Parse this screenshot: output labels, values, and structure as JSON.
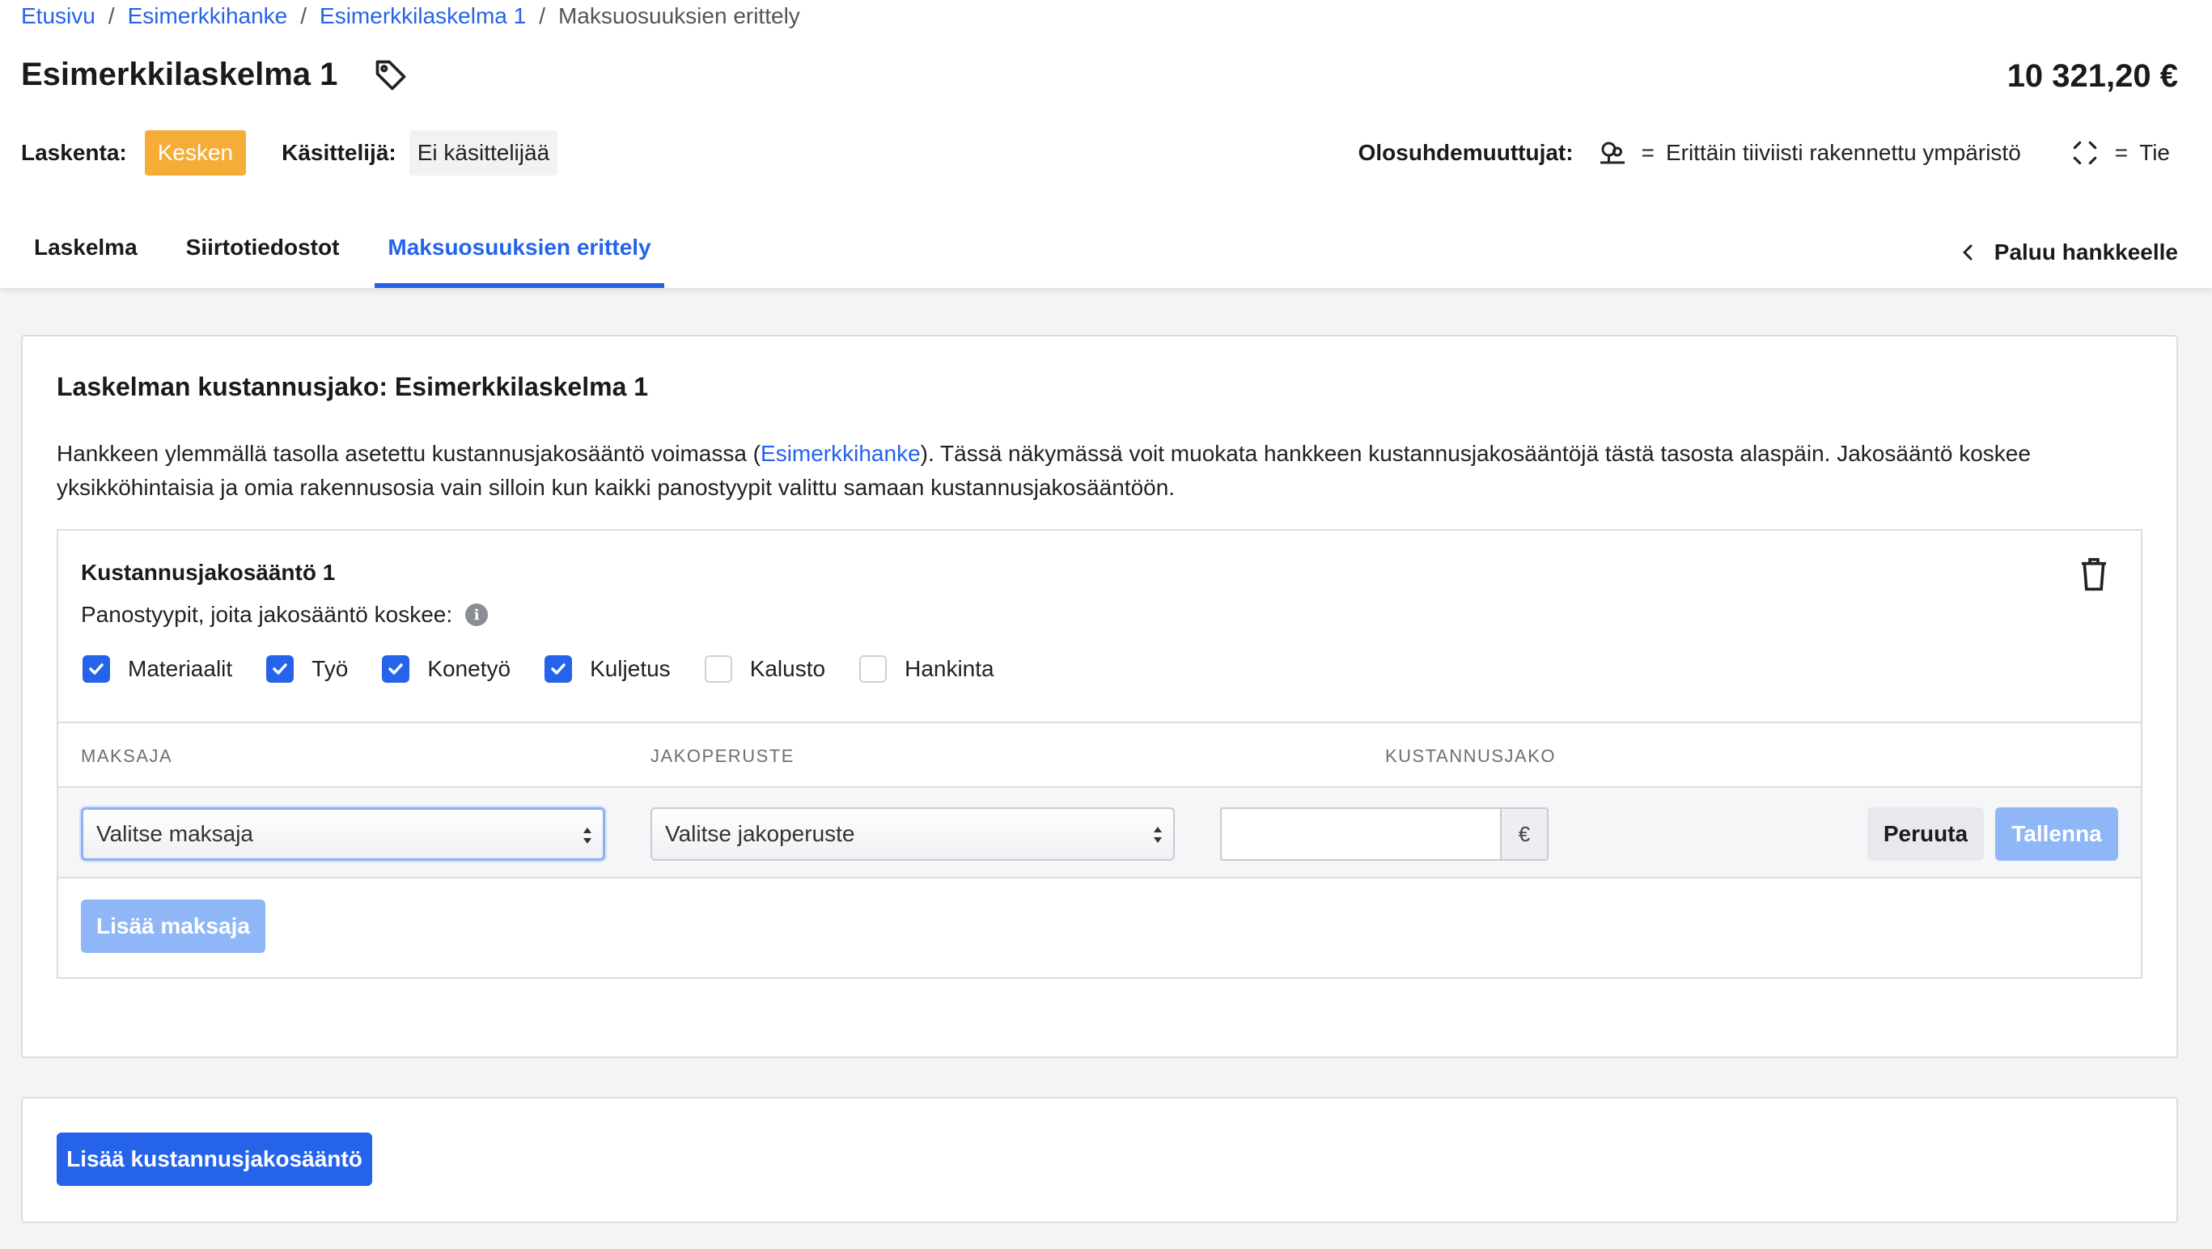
{
  "breadcrumb": {
    "items": [
      "Etusivu",
      "Esimerkkihanke",
      "Esimerkkilaskelma 1"
    ],
    "separator": "/",
    "current": "Maksuosuuksien erittely"
  },
  "header": {
    "title": "Esimerkkilaskelma 1",
    "total": "10 321,20 €",
    "status_label": "Laskenta:",
    "status_value": "Kesken",
    "handler_label": "Käsittelijä:",
    "handler_value": "Ei käsittelijää",
    "vars_label": "Olosuhdemuuttujat:",
    "vars": [
      {
        "icon": "terrain-icon",
        "eq": "=",
        "text": "Erittäin tiiviisti rakennettu ympäristö"
      },
      {
        "icon": "road-icon",
        "eq": "=",
        "text": "Tie"
      }
    ]
  },
  "tabs": [
    {
      "label": "Laskelma",
      "active": false
    },
    {
      "label": "Siirtotiedostot",
      "active": false
    },
    {
      "label": "Maksuosuuksien erittely",
      "active": true
    }
  ],
  "back_link": "Paluu hankkeelle",
  "main": {
    "title": "Laskelman kustannusjako: Esimerkkilaskelma 1",
    "desc_before": "Hankkeen ylemmällä tasolla asetettu kustannusjakosääntö voimassa (",
    "desc_link": "Esimerkkihanke",
    "desc_after": "). Tässä näkymässä voit muokata hankkeen kustannusjakosääntöjä tästä tasosta alaspäin. Jakosääntö koskee yksikköhintaisia ja omia rakennusosia vain silloin kun kaikki panostyypit valittu samaan kustannusjakosääntöön.",
    "rule": {
      "title": "Kustannusjakosääntö 1",
      "subtitle": "Panostyypit, joita jakosääntö koskee:",
      "checkboxes": [
        {
          "label": "Materiaalit",
          "checked": true
        },
        {
          "label": "Työ",
          "checked": true
        },
        {
          "label": "Konetyö",
          "checked": true
        },
        {
          "label": "Kuljetus",
          "checked": true
        },
        {
          "label": "Kalusto",
          "checked": false
        },
        {
          "label": "Hankinta",
          "checked": false
        }
      ],
      "columns": [
        "MAKSAJA",
        "JAKOPERUSTE",
        "KUSTANNUSJAKO"
      ],
      "payer_placeholder": "Valitse maksaja",
      "basis_placeholder": "Valitse jakoperuste",
      "amount_value": "",
      "currency": "€",
      "cancel_label": "Peruuta",
      "save_label": "Tallenna",
      "add_payer_label": "Lisää maksaja"
    }
  },
  "bottom": {
    "add_rule_label": "Lisää kustannusjakosääntö"
  },
  "colors": {
    "accent": "#2563eb",
    "status": "#f6ad37",
    "disabled_button": "#8fb7f7"
  }
}
